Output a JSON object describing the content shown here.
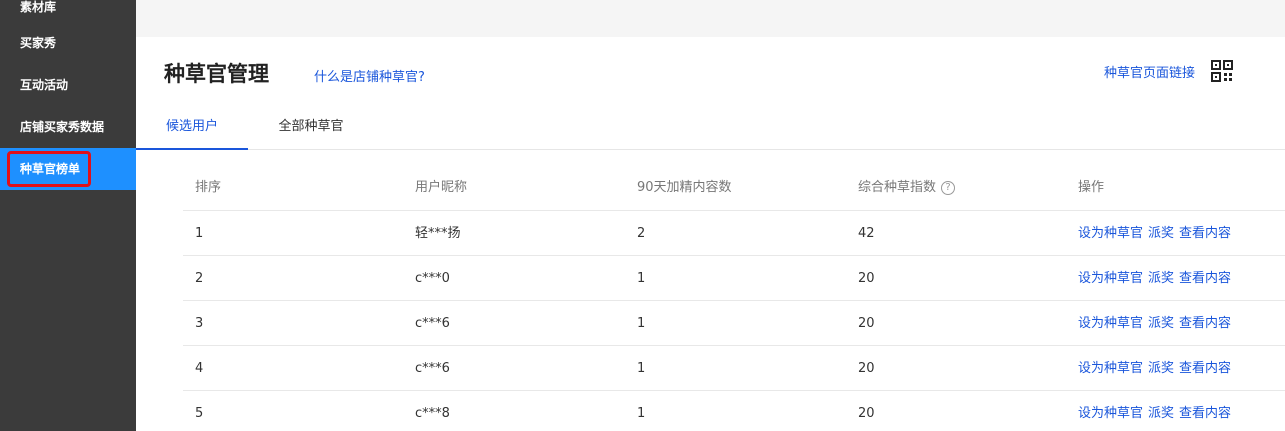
{
  "sidebar": {
    "items": [
      {
        "label": "素材库"
      },
      {
        "label": "买家秀"
      },
      {
        "label": "互动活动"
      },
      {
        "label": "店铺买家秀数据"
      },
      {
        "label": "种草官榜单",
        "active": true
      }
    ]
  },
  "header": {
    "title": "种草官管理",
    "help_link": "什么是店铺种草官?",
    "page_link": "种草官页面链接",
    "qr_icon": "qr-code-icon"
  },
  "tabs": [
    {
      "label": "候选用户",
      "active": true
    },
    {
      "label": "全部种草官"
    }
  ],
  "table": {
    "columns": [
      "排序",
      "用户昵称",
      "90天加精内容数",
      "综合种草指数",
      "操作"
    ],
    "help_icon": "?",
    "actions": [
      "设为种草官",
      "派奖",
      "查看内容"
    ],
    "rows": [
      {
        "rank": "1",
        "nickname": "轻***扬",
        "featured": "2",
        "score": "42"
      },
      {
        "rank": "2",
        "nickname": "c***0",
        "featured": "1",
        "score": "20"
      },
      {
        "rank": "3",
        "nickname": "c***6",
        "featured": "1",
        "score": "20"
      },
      {
        "rank": "4",
        "nickname": "c***6",
        "featured": "1",
        "score": "20"
      },
      {
        "rank": "5",
        "nickname": "c***8",
        "featured": "1",
        "score": "20"
      }
    ]
  },
  "colors": {
    "sidebar_bg": "#3b3b3b",
    "active_bg": "#1e90ff",
    "highlight_border": "#e0101a",
    "link": "#1a56db"
  }
}
